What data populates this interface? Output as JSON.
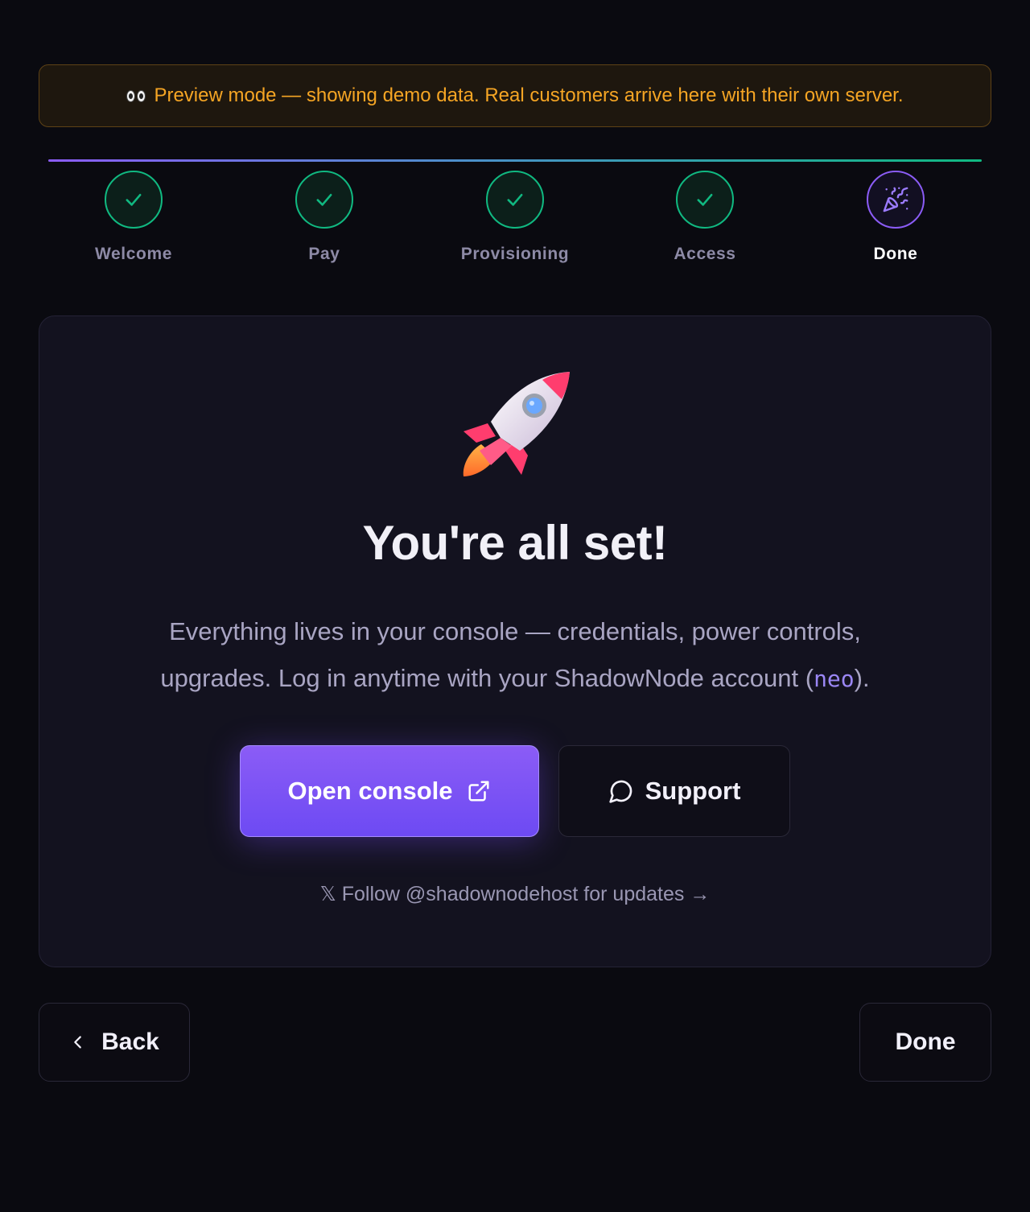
{
  "banner": {
    "icon": "eyes-icon",
    "text": "Preview mode — showing demo data. Real customers arrive here with their own server."
  },
  "stepper": {
    "steps": [
      {
        "label": "Welcome",
        "state": "complete",
        "icon": "check-icon"
      },
      {
        "label": "Pay",
        "state": "complete",
        "icon": "check-icon"
      },
      {
        "label": "Provisioning",
        "state": "complete",
        "icon": "check-icon"
      },
      {
        "label": "Access",
        "state": "complete",
        "icon": "check-icon"
      },
      {
        "label": "Done",
        "state": "current",
        "icon": "party-popper-icon"
      }
    ],
    "colors": {
      "complete": "#10b981",
      "current": "#8b5cf6"
    }
  },
  "card": {
    "hero_icon": "rocket-icon",
    "title": "You're all set!",
    "desc_before": "Everything lives in your console — credentials, power controls, upgrades. Log in anytime with your ShadowNode account (",
    "desc_user": "neo",
    "desc_after": ").",
    "primary_button": {
      "label": "Open console",
      "icon": "external-link-icon"
    },
    "secondary_button": {
      "label": "Support",
      "icon": "chat-bubble-icon"
    },
    "follow_link": "𝕏 Follow @shadownodehost for updates →"
  },
  "footer": {
    "back_label": "Back",
    "back_icon": "chevron-left-icon",
    "done_label": "Done"
  },
  "colors": {
    "accent": "#8b5cf6",
    "success": "#10b981",
    "warning": "#f5a524",
    "background": "#0a0a10"
  }
}
